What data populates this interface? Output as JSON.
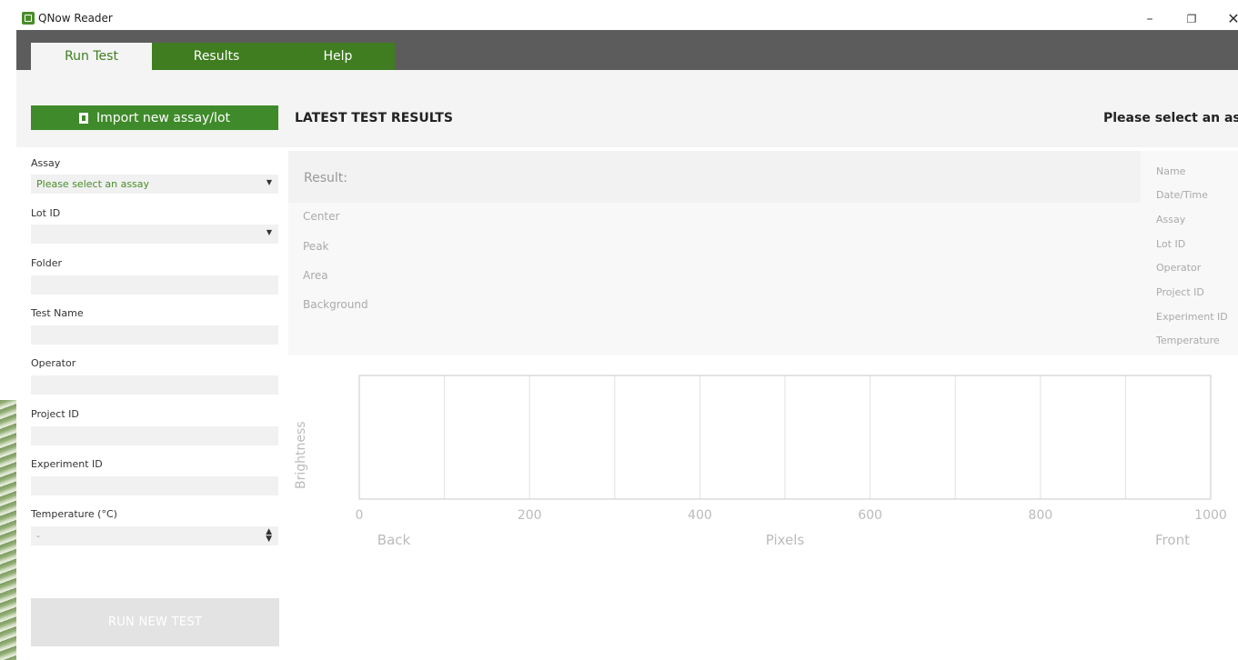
{
  "window": {
    "title": "QNow Reader",
    "controls": {
      "minimize": "–",
      "maximize": "❐",
      "close": "✕"
    }
  },
  "tabs": [
    {
      "label": "Run Test",
      "active": true
    },
    {
      "label": "Results",
      "active": false
    },
    {
      "label": "Help",
      "active": false
    }
  ],
  "toolbar": {
    "import_label": "Import new assay/lot"
  },
  "latest": {
    "title": "LATEST TEST RESULTS",
    "select_assay_message": "Please select an assay"
  },
  "form": {
    "assay": {
      "label": "Assay",
      "value": "Please select an assay"
    },
    "lot_id": {
      "label": "Lot ID",
      "value": ""
    },
    "folder": {
      "label": "Folder",
      "value": ""
    },
    "test_name": {
      "label": "Test Name",
      "value": ""
    },
    "operator": {
      "label": "Operator",
      "value": ""
    },
    "project_id": {
      "label": "Project ID",
      "value": ""
    },
    "experiment_id": {
      "label": "Experiment ID",
      "value": ""
    },
    "temperature": {
      "label": "Temperature (°C)",
      "value": "-"
    },
    "run_label": "RUN NEW TEST"
  },
  "result": {
    "title": "Result:",
    "metrics": [
      "Center",
      "Peak",
      "Area",
      "Background"
    ],
    "meta": [
      "Name",
      "Date/Time",
      "Assay",
      "Lot ID",
      "Operator",
      "Project ID",
      "Experiment ID",
      "Temperature"
    ]
  },
  "chart_data": {
    "type": "line",
    "ylabel": "Brightness",
    "xlabel": "Pixels",
    "x_left_label": "Back",
    "x_right_label": "Front",
    "xlim": [
      0,
      1000
    ],
    "xticks": [
      "0",
      "200",
      "400",
      "600",
      "800",
      "1000"
    ],
    "grid_step": 100,
    "series": []
  },
  "colors": {
    "accent_green": "#3f7d20",
    "tab_bar": "#5c5c5c"
  }
}
